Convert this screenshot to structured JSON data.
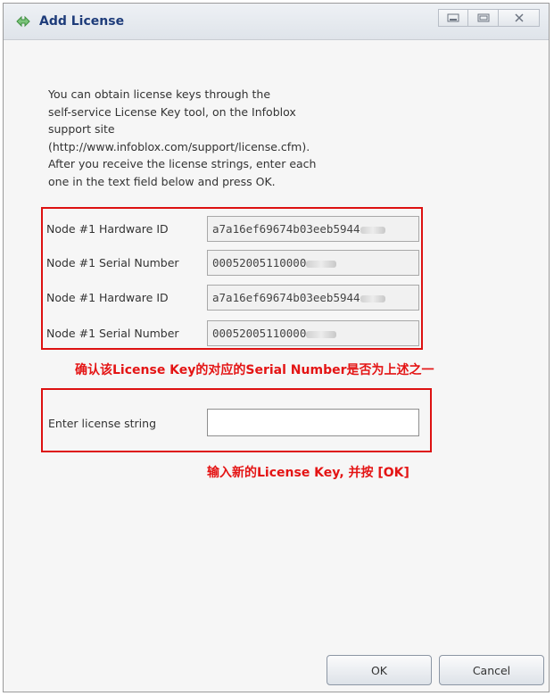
{
  "window": {
    "title": "Add License",
    "controls": [
      "minimize-icon",
      "maximize-icon",
      "close-icon"
    ]
  },
  "description": "You can obtain license keys through the\nself-service License Key tool, on the Infoblox\nsupport site\n(http://www.infoblox.com/support/license.cfm).\nAfter you receive the license strings, enter each\none in the text field below and press OK.",
  "nodes": [
    {
      "hw_label": "Node #1 Hardware ID",
      "hw_value": "a7a16ef69674b03eeb5944",
      "sn_label": "Node #1 Serial Number",
      "sn_value": "00052005110000"
    },
    {
      "hw_label": "Node #1 Hardware ID",
      "hw_value": "a7a16ef69674b03eeb5944",
      "sn_label": "Node #1 Serial Number",
      "sn_value": "00052005110000"
    }
  ],
  "annotation_verify": "确认该License Key的对应的Serial Number是否为上述之一",
  "license_input": {
    "label": "Enter license string",
    "value": ""
  },
  "annotation_enter": "输入新的License Key, 并按 [OK]",
  "buttons": {
    "ok": "OK",
    "cancel": "Cancel"
  },
  "colors": {
    "accent_red": "#dd1111",
    "title_text": "#1e3c7a"
  }
}
